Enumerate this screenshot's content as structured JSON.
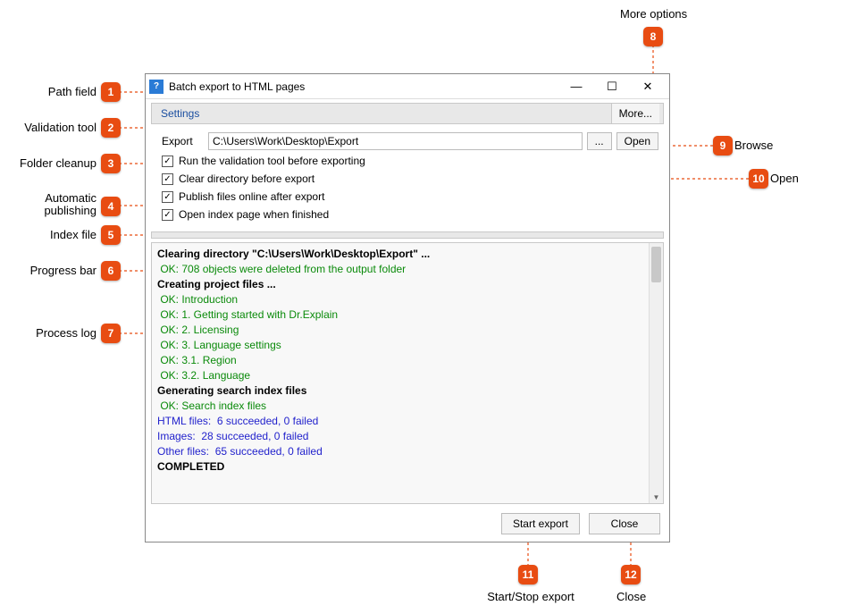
{
  "window": {
    "title": "Batch export to HTML pages"
  },
  "settings_bar": {
    "label": "Settings",
    "more": "More..."
  },
  "form": {
    "export_label": "Export",
    "path": "C:\\Users\\Work\\Desktop\\Export",
    "browse_label": "...",
    "open_label": "Open",
    "chk_validation": "Run the validation tool before exporting",
    "chk_clear": "Clear directory before export",
    "chk_publish": "Publish files online after export",
    "chk_index": "Open index page when finished"
  },
  "log": {
    "lines": [
      {
        "text": "Clearing directory \"C:\\Users\\Work\\Desktop\\Export\" ...",
        "cls": "bold"
      },
      {
        "text": " OK: 708 objects were deleted from the output folder",
        "cls": "green"
      },
      {
        "text": "Creating project files ...",
        "cls": "bold"
      },
      {
        "text": " OK: Introduction",
        "cls": "green"
      },
      {
        "text": " OK: 1. Getting started with Dr.Explain",
        "cls": "green"
      },
      {
        "text": " OK: 2. Licensing",
        "cls": "green"
      },
      {
        "text": " OK: 3. Language settings",
        "cls": "green"
      },
      {
        "text": " OK: 3.1. Region",
        "cls": "green"
      },
      {
        "text": " OK: 3.2. Language",
        "cls": "green"
      },
      {
        "text": "Generating search index files",
        "cls": "bold"
      },
      {
        "text": " OK: Search index files",
        "cls": "green"
      },
      {
        "text": "HTML files:  6 succeeded, 0 failed",
        "cls": "blue"
      },
      {
        "text": "Images:  28 succeeded, 0 failed",
        "cls": "blue"
      },
      {
        "text": "Other files:  65 succeeded, 0 failed",
        "cls": "blue"
      },
      {
        "text": "COMPLETED",
        "cls": "bold"
      }
    ]
  },
  "footer": {
    "start": "Start export",
    "close": "Close"
  },
  "callouts": {
    "1": "Path field",
    "2": "Validation tool",
    "3": "Folder cleanup",
    "4": "Automatic publishing",
    "5": "Index file",
    "6": "Progress bar",
    "7": "Process log",
    "8": "More options",
    "9": "Browse",
    "10": "Open",
    "11": "Start/Stop export",
    "12": "Close"
  }
}
